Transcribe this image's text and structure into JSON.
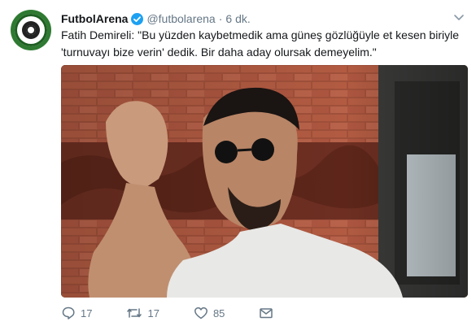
{
  "tweet": {
    "author_name": "FutbolArena",
    "handle": "@futbolarena",
    "separator": "·",
    "time": "6 dk.",
    "text": "Fatih Demireli: \"Bu yüzden kaybetmedik ama güneş gözlüğüyle et kesen biriyle 'turnuvayı bize verin' dedik. Bir daha aday olursak demeyelim.\""
  },
  "actions": {
    "reply_count": "17",
    "retweet_count": "17",
    "like_count": "85"
  },
  "icons": {
    "verified": "verified-badge-icon",
    "caret": "chevron-down-icon",
    "reply": "reply-icon",
    "retweet": "retweet-icon",
    "like": "heart-icon",
    "dm": "envelope-icon"
  },
  "colors": {
    "accent": "#1da1f2",
    "muted": "#657786",
    "text": "#14171a"
  }
}
